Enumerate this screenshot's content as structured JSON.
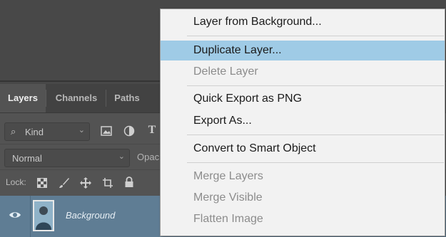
{
  "panel": {
    "tabs": [
      {
        "label": "Layers",
        "active": true
      },
      {
        "label": "Channels",
        "active": false
      },
      {
        "label": "Paths",
        "active": false
      }
    ],
    "filter": {
      "icon": "search-icon",
      "label": "Kind"
    },
    "blend_mode": "Normal",
    "opacity_label": "Opac",
    "lock_label": "Lock:",
    "layer": {
      "name": "Background",
      "visible": true
    }
  },
  "context_menu": {
    "items": [
      {
        "label": "Layer from Background...",
        "enabled": true,
        "highlighted": false
      },
      {
        "label": "Duplicate Layer...",
        "enabled": true,
        "highlighted": true
      },
      {
        "label": "Delete Layer",
        "enabled": false,
        "highlighted": false
      },
      {
        "label": "Quick Export as PNG",
        "enabled": true,
        "highlighted": false
      },
      {
        "label": "Export As...",
        "enabled": true,
        "highlighted": false
      },
      {
        "label": "Convert to Smart Object",
        "enabled": true,
        "highlighted": false
      },
      {
        "label": "Merge Layers",
        "enabled": false,
        "highlighted": false
      },
      {
        "label": "Merge Visible",
        "enabled": false,
        "highlighted": false
      },
      {
        "label": "Flatten Image",
        "enabled": false,
        "highlighted": false
      }
    ]
  },
  "colors": {
    "highlight": "#9fcbe6",
    "selected_layer": "#5f7d94"
  }
}
